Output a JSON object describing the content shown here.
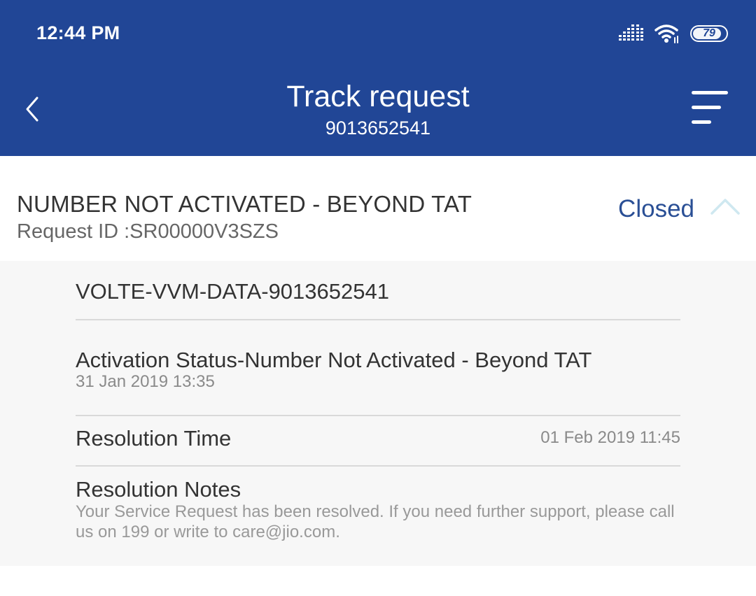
{
  "status_bar": {
    "time": "12:44 PM",
    "battery": "79",
    "battery_level": 0.79,
    "icons": [
      "signal-icon",
      "wifi-icon",
      "battery-icon"
    ]
  },
  "header": {
    "title": "Track request",
    "subtitle": "9013652541",
    "back_icon": "chevron-left-icon",
    "menu_icon": "menu-icon"
  },
  "request": {
    "title": "NUMBER NOT ACTIVATED - BEYOND TAT",
    "request_id": "Request ID :SR00000V3SZS",
    "status": "Closed",
    "collapse_icon": "chevron-up-icon"
  },
  "details": {
    "plan": "VOLTE-VVM-DATA-9013652541",
    "activation_status": "Activation Status-Number Not Activated - Beyond TAT",
    "activation_date": "31 Jan 2019 13:35",
    "resolution_time_label": "Resolution Time",
    "resolution_time_value": "01 Feb 2019 11:45",
    "resolution_notes_label": "Resolution Notes",
    "resolution_notes_text": "Your Service Request has been resolved. If you need further support, please call us on 199 or write to care@jio.com."
  },
  "colors": {
    "header_background": "#214696",
    "status_accent": "#2a4f95",
    "chevron_accent": "#cfe8f0",
    "details_background": "#f7f7f7"
  }
}
